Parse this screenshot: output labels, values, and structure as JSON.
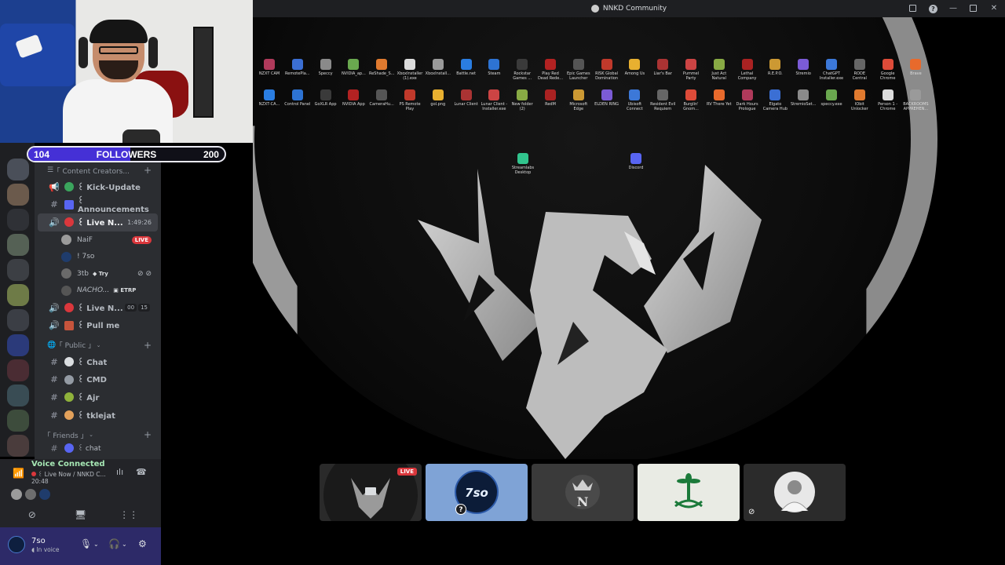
{
  "window": {
    "title": "NNKD Community"
  },
  "followers": {
    "current": "104",
    "label": "FOLLOWERS",
    "goal": "200",
    "progress": 0.52
  },
  "channels": {
    "categories": [
      {
        "label": "｢ Content Creators... ",
        "chevron": "⌄"
      },
      {
        "label": "｢ Public ｣",
        "chevron": "⌄"
      },
      {
        "label": "｢ Friends ｣",
        "chevron": "⌄"
      }
    ],
    "items": [
      {
        "name": "꒰ Kick-Update",
        "icon": "megaphone-icon"
      },
      {
        "name": "꒰ Announcements",
        "icon": "hash-icon"
      },
      {
        "name": "꒰ Live N...",
        "icon": "speaker-icon",
        "time": "1:49:26"
      },
      {
        "name": "꒰ Live N...",
        "icon": "speaker-icon",
        "count_a": "00",
        "count_b": "15"
      },
      {
        "name": "꒰ Pull me",
        "icon": "speaker-icon"
      },
      {
        "name": "꒰ Chat",
        "icon": "hash-icon"
      },
      {
        "name": "꒰ CMD",
        "icon": "hash-icon"
      },
      {
        "name": "꒰ Ajr",
        "icon": "hash-icon"
      },
      {
        "name": "꒰ tklejat",
        "icon": "hash-icon"
      },
      {
        "name": "꒰ chat",
        "icon": "hash-icon"
      }
    ],
    "voice_users": [
      {
        "name": "NaiF",
        "badge": "LIVE"
      },
      {
        "name": "! 7so"
      },
      {
        "name": "3tb",
        "tag": "Try"
      },
      {
        "name": "NACHO...",
        "tag": "ETRP"
      }
    ]
  },
  "voice": {
    "status": "Voice Connected",
    "channel": "꒰ Live Now / NNKD C...",
    "time": "20:48"
  },
  "user": {
    "name": "7so",
    "status": "In voice"
  },
  "desktop_icons_row1": [
    "NZXT CAM",
    "RemotePla...",
    "Speccy",
    "NVIDIA_ap...",
    "ReShade_S...",
    "XboxInstaller (1).exe",
    "XboxInstall...",
    "Battle.net",
    "Steam",
    "Rockstar Games ...",
    "Play Red Dead Rede...",
    "Epic Games Launcher",
    "RISK Global Domination",
    "Among Us",
    "Liar's Bar",
    "Pummel Party",
    "Just Act Natural",
    "Lethal Company",
    "R.E.P.O.",
    "Stremio",
    "ChatGPT Installer.exe",
    "RODE Central",
    "Google Chrome",
    "Brave"
  ],
  "desktop_icons_row2": [
    "NZXT-CA...",
    "Control Panel",
    "GoXLR App",
    "NVIDIA App",
    "CameraHu...",
    "PS Remote Play",
    "gol.png",
    "Lunar Client",
    "Lunar Client - Installer.exe",
    "New folder (2)",
    "RedM",
    "Microsoft Edge",
    "ELDEN RING",
    "Ubisoft Connect",
    "Resident Evil Requiem",
    "Burglin' Gnom...",
    "RV There Yet",
    "Dark Hours Prologue",
    "Elgato Camera Hub",
    "StremioSet...",
    "speccy.exe",
    "IObit Unlocker",
    "Person 1 - Chrome",
    "BACKROOMS APPREHEN..."
  ],
  "desktop_icons_row3": [
    "Streamlabs Desktop",
    "Discord"
  ],
  "tiles": [
    {
      "badge": "LIVE"
    },
    {
      "badge": "?"
    },
    {},
    {},
    {}
  ],
  "colors": {
    "accent": "#4530d6",
    "live": "#da373c",
    "sidebar": "#2b2d31",
    "userbar": "#2d2a68"
  }
}
